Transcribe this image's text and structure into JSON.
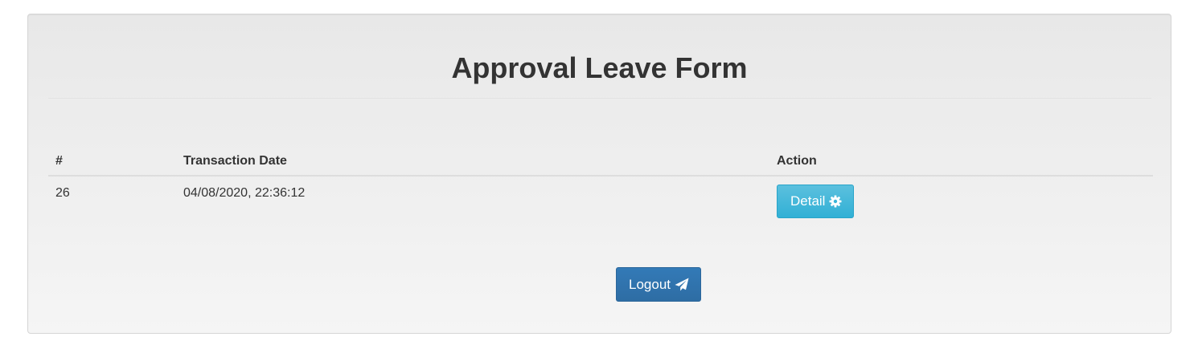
{
  "page": {
    "title": "Approval Leave Form"
  },
  "table": {
    "headers": {
      "id": "#",
      "transaction_date": "Transaction Date",
      "action": "Action"
    },
    "rows": [
      {
        "id": "26",
        "transaction_date": "04/08/2020, 22:36:12",
        "action_label": "Detail",
        "action_icon": "gear-icon"
      }
    ]
  },
  "logout": {
    "label": "Logout",
    "icon": "paper-plane-icon"
  },
  "colors": {
    "detail_button": "#5bc0de",
    "logout_button": "#337ab7",
    "panel_background": "#eeeeee",
    "text": "#333333"
  }
}
